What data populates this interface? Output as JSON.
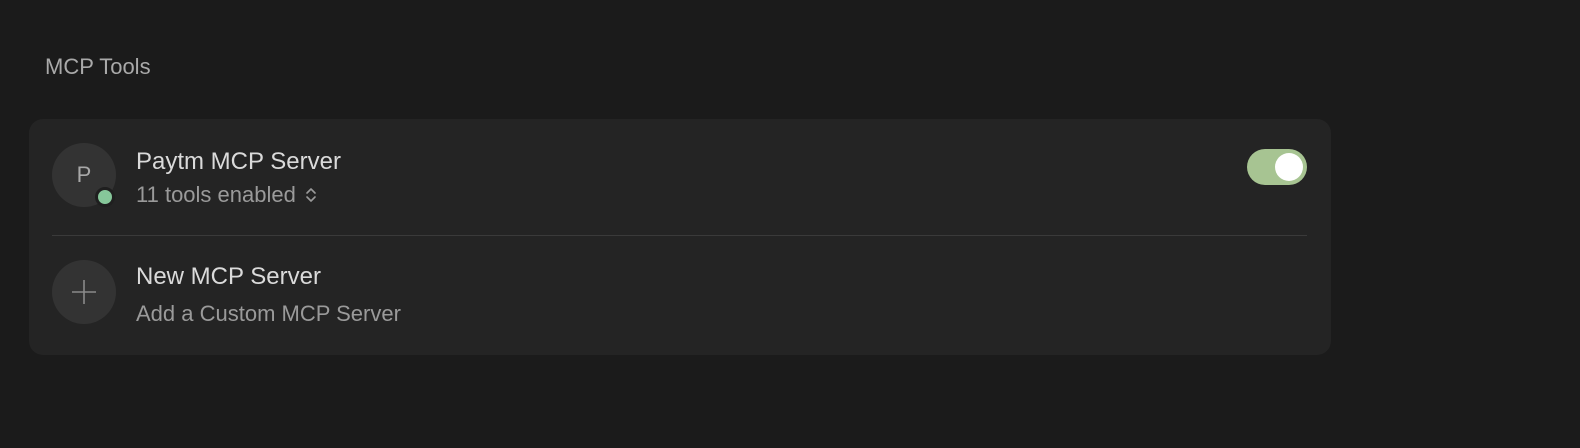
{
  "section": {
    "title": "MCP Tools"
  },
  "servers": [
    {
      "avatar_letter": "P",
      "name": "Paytm MCP Server",
      "tools_summary": "11 tools enabled",
      "status": "connected",
      "enabled": true
    }
  ],
  "new_server": {
    "title": "New MCP Server",
    "subtitle": "Add a Custom MCP Server"
  },
  "colors": {
    "background": "#1b1b1b",
    "card": "#242424",
    "status_connected": "#86c79a",
    "toggle_on": "#a7c492"
  },
  "icons": {
    "status": "status-dot",
    "tools_selector": "chevron-up-down-icon",
    "add": "plus-icon"
  }
}
